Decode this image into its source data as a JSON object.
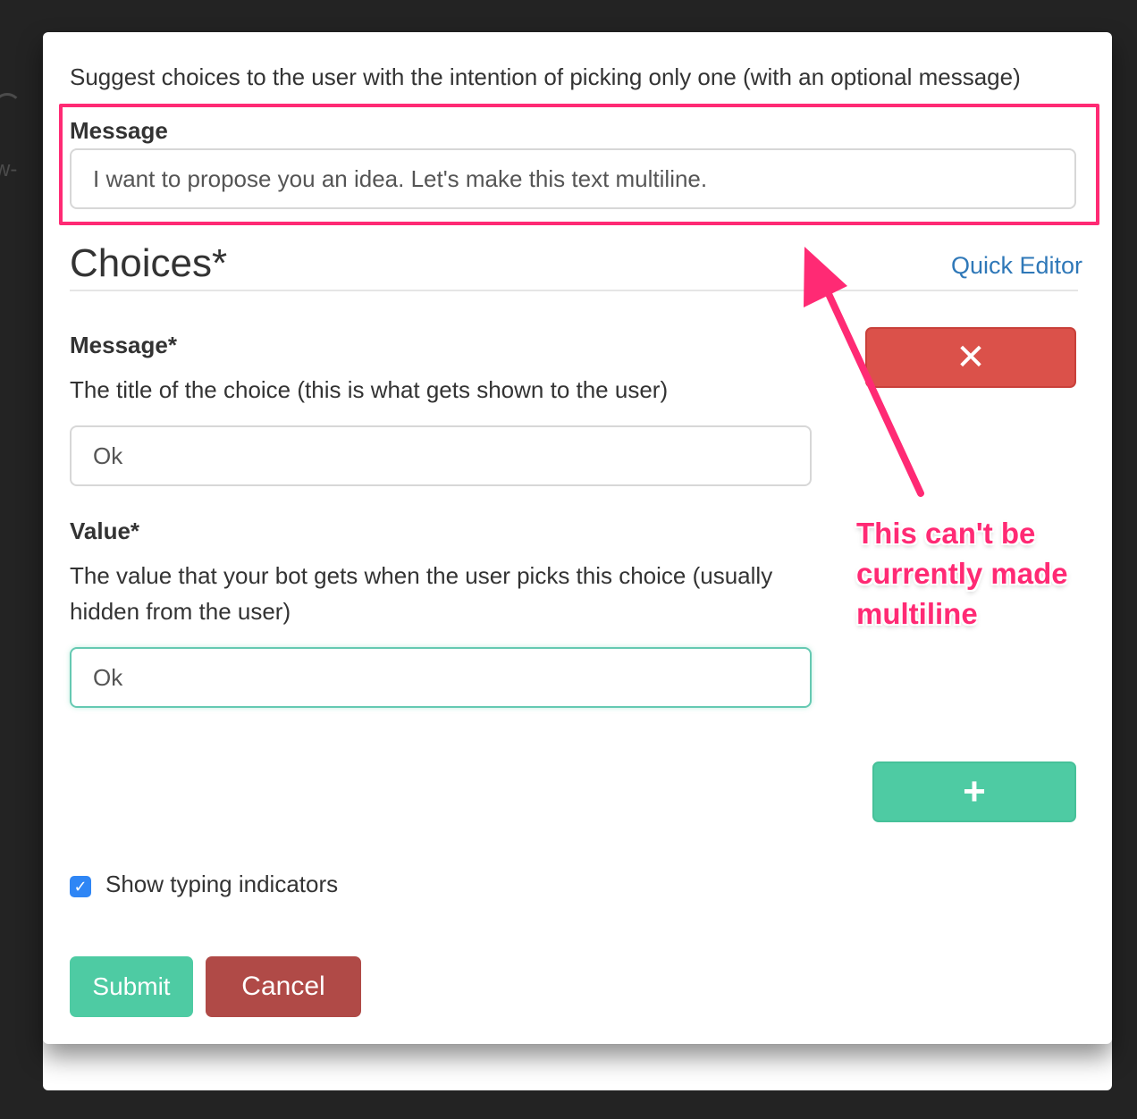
{
  "form": {
    "description": "Suggest choices to the user with the intention of picking only one (with an optional message)",
    "message_label": "Message",
    "message_value": "I want to propose you an idea. Let's make this text multiline.",
    "choices_title": "Choices*",
    "quick_editor_label": "Quick Editor",
    "choice_message_label": "Message*",
    "choice_message_help": "The title of the choice (this is what gets shown to the user)",
    "choice_message_value": "Ok",
    "value_label": "Value*",
    "value_help": "The value that your bot gets when the user picks this choice (usually hidden from the user)",
    "value_value": "Ok",
    "remove_choice_icon": "close-icon",
    "add_choice_icon": "plus-icon",
    "show_typing_label": "Show typing indicators",
    "show_typing_checked": true,
    "submit_label": "Submit",
    "cancel_label": "Cancel"
  },
  "annotation": {
    "text": "This can't be currently made multiline"
  },
  "colors": {
    "highlight": "#ff2a74",
    "danger": "#db514a",
    "success": "#4ecba3",
    "link": "#2f78b8",
    "checkbox": "#2f86f5",
    "cancel": "#b04a47"
  }
}
